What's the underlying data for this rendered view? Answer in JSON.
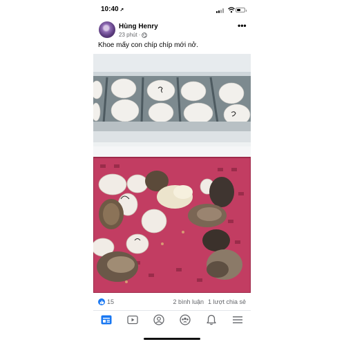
{
  "status_bar": {
    "time": "10:40",
    "location_arrow": "location-arrow-icon",
    "icons": [
      "signal-icon",
      "wifi-icon",
      "battery-icon"
    ]
  },
  "post": {
    "author": "Hùng Henry",
    "time_ago": "23 phút",
    "separator": "·",
    "audience_icon": "globe-icon",
    "more_label": "•••",
    "caption": "Khoe mấy con chíp chíp mới nở.",
    "photo_icon": "post-photo"
  },
  "reactions": {
    "like_count": "15",
    "comments": "2 bình luận",
    "shares": "1 lượt chia sẻ"
  },
  "nav": {
    "tabs": [
      "home-feed-icon",
      "watch-icon",
      "profile-icon",
      "groups-icon",
      "notifications-icon",
      "menu-icon"
    ]
  },
  "colors": {
    "accent": "#1877f2",
    "meta_text": "#65676b",
    "basket": "#c23d62"
  }
}
